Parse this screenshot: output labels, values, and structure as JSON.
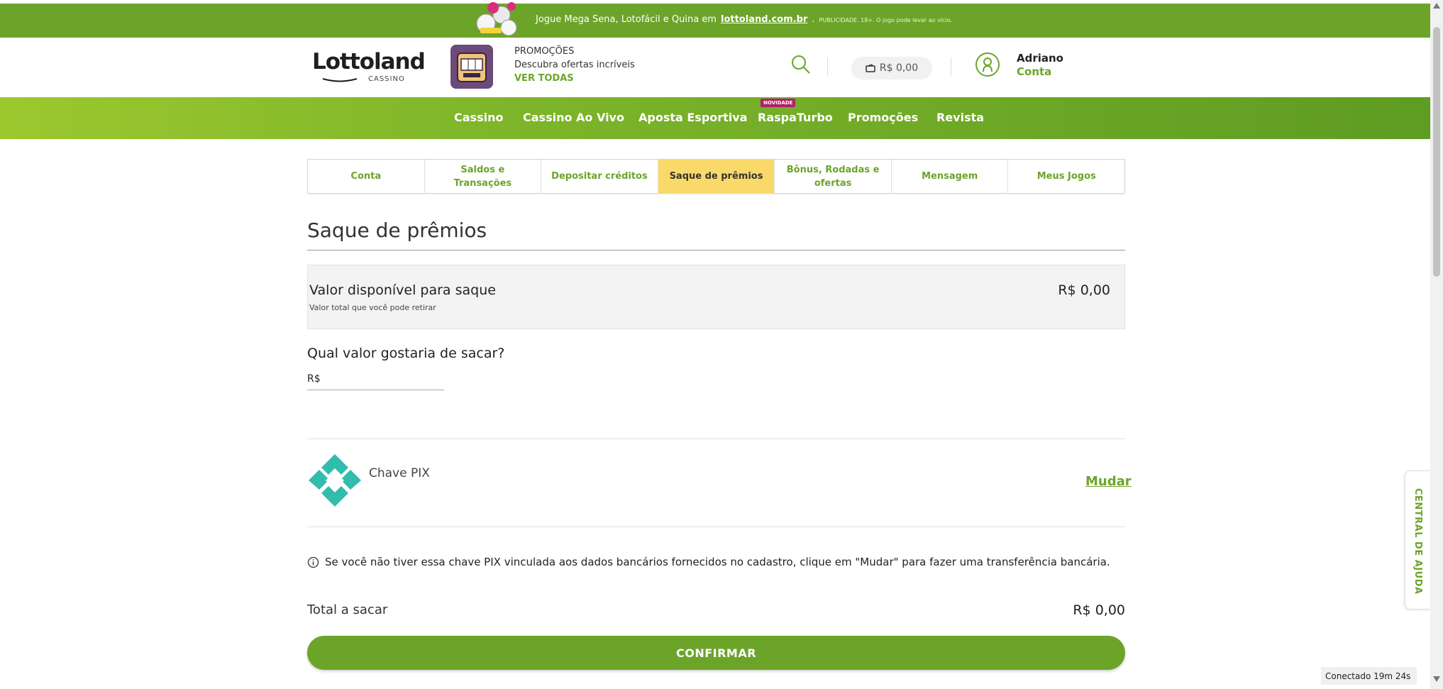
{
  "promo_bar": {
    "text": "Jogue Mega Sena, Lotofácil e Quina em",
    "link": "lottoland.com.br",
    "period": ".",
    "disclaimer": "PUBLICIDADE. 18+. O jogo pode levar ao vício.",
    "bg_color": "#6ca42a"
  },
  "header": {
    "brand": "Lottoland",
    "brand_sub": "CASSINO",
    "promo_title": "PROMOÇÕES",
    "promo_desc": "Descubra ofertas incríveis",
    "promo_link": "VER TODAS",
    "search_icon": "search-icon",
    "balance": "R$ 0,00",
    "wallet_icon": "wallet-icon",
    "user_icon": "user-circle-icon",
    "user_name": "Adriano",
    "user_account": "Conta"
  },
  "nav": {
    "items": [
      "Cassino",
      "Cassino Ao Vivo",
      "Aposta Esportiva",
      "RaspaTurbo",
      "Promoções",
      "Revista"
    ],
    "badge": "NOVIDADE"
  },
  "tabs": [
    {
      "label": "Conta",
      "active": false
    },
    {
      "label": "Saldos e Transações",
      "active": false
    },
    {
      "label": "Depositar créditos",
      "active": false
    },
    {
      "label": "Saque de prêmios",
      "active": true
    },
    {
      "label": "Bônus, Rodadas e ofertas",
      "active": false
    },
    {
      "label": "Mensagem",
      "active": false
    },
    {
      "label": "Meus Jogos",
      "active": false
    }
  ],
  "page": {
    "title": "Saque de prêmios",
    "available_label": "Valor disponível para saque",
    "available_sub": "Valor total que você pode retirar",
    "available_amount": "R$ 0,00",
    "question": "Qual valor gostaria de sacar?",
    "currency_prefix": "R$",
    "amount_value": "",
    "pix_label": "Chave PIX",
    "pix_change": "Mudar",
    "info_text": "Se você não tiver essa chave PIX vinculada aos dados bancários fornecidos no cadastro, clique em \"Mudar\" para fazer uma transferência bancária.",
    "total_label": "Total a sacar",
    "total_amount": "R$ 0,00",
    "confirm_label": "CONFIRMAR"
  },
  "help_tab": "CENTRAL DE AJUDA",
  "status": "Conectado 19m 24s",
  "colors": {
    "accent": "#6ca42a",
    "active_tab": "#f8d96a",
    "pix": "#32bcad"
  }
}
